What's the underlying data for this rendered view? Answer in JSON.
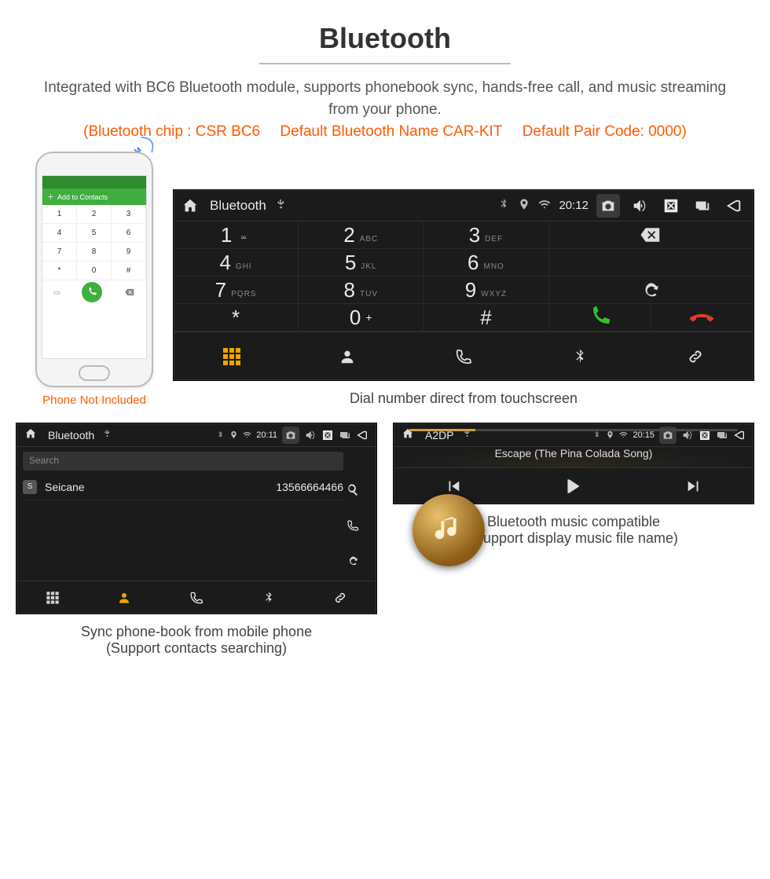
{
  "title": "Bluetooth",
  "intro": "Integrated with BC6 Bluetooth module, supports phonebook sync, hands-free call, and music streaming from your phone.",
  "specs": {
    "chip": "(Bluetooth chip : CSR BC6",
    "name": "Default Bluetooth Name CAR-KIT",
    "pair": "Default Pair Code: 0000)"
  },
  "phone_mock": {
    "add_label": "Add to Contacts",
    "keys": [
      "1",
      "2",
      "3",
      "4",
      "5",
      "6",
      "7",
      "8",
      "9",
      "*",
      "0",
      "#"
    ],
    "note": "Phone Not Included"
  },
  "dialer": {
    "app_title": "Bluetooth",
    "clock": "20:12",
    "keys": [
      {
        "d": "1",
        "s": "∞"
      },
      {
        "d": "2",
        "s": "ABC"
      },
      {
        "d": "3",
        "s": "DEF"
      },
      {
        "d": "4",
        "s": "GHI"
      },
      {
        "d": "5",
        "s": "JKL"
      },
      {
        "d": "6",
        "s": "MNO"
      },
      {
        "d": "7",
        "s": "PQRS"
      },
      {
        "d": "8",
        "s": "TUV"
      },
      {
        "d": "9",
        "s": "WXYZ"
      },
      {
        "d": "*",
        "s": ""
      },
      {
        "d": "0",
        "s": "+"
      },
      {
        "d": "#",
        "s": ""
      }
    ],
    "caption": "Dial number direct from touchscreen"
  },
  "contacts": {
    "app_title": "Bluetooth",
    "clock": "20:11",
    "search_placeholder": "Search",
    "row": {
      "badge": "S",
      "name": "Seicane",
      "number": "13566664466"
    },
    "caption_line1": "Sync phone-book from mobile phone",
    "caption_line2": "(Support contacts searching)"
  },
  "music": {
    "app_title": "A2DP",
    "clock": "20:15",
    "track": "Escape (The Pina Colada Song)",
    "caption_line1": "Bluetooth music compatible",
    "caption_line2": "(Support display music file name)"
  }
}
